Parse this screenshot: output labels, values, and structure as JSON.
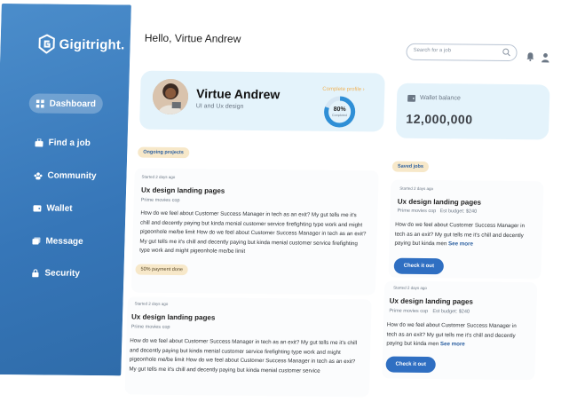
{
  "brand": {
    "name": "Gigitright."
  },
  "sidebar": {
    "items": [
      {
        "label": "Dashboard",
        "icon": "dashboard-icon",
        "active": true
      },
      {
        "label": "Find a job",
        "icon": "briefcase-icon"
      },
      {
        "label": "Community",
        "icon": "community-icon"
      },
      {
        "label": "Wallet",
        "icon": "wallet-icon"
      },
      {
        "label": "Message",
        "icon": "message-icon"
      },
      {
        "label": "Security",
        "icon": "lock-icon"
      }
    ]
  },
  "header": {
    "greeting": "Hello, Virtue Andrew",
    "search_placeholder": "Search for a job"
  },
  "profile": {
    "name": "Virtue Andrew",
    "role": "UI and Ux design",
    "complete_label": "Complete profile",
    "progress_percent": 80,
    "progress_label": "80%",
    "progress_sub": "Completed"
  },
  "wallet": {
    "label": "Wallet balance",
    "value": "12,000,000"
  },
  "ongoing": {
    "tag": "Ongoing projects",
    "projects": [
      {
        "started": "Started 2 days ago",
        "title": "Ux design landing pages",
        "company": "Prime movies cop",
        "desc": "How do we feel about Customer Success Manager in tech as an exit? My gut tells me it's chill and decently paying but kinda menial customer service firefighting type work and might pigeonhole me/be limit How do we feel about Customer Success Manager in tech as an exit? My gut tells me it's chill and decently paying but kinda menial customer service firefighting type work and might pigeonhole me/be limit",
        "badge": "50% payment done"
      },
      {
        "started": "Started 2 days ago",
        "title": "Ux design landing pages",
        "company": "Prime movies cop",
        "desc": "How do we feel about Customer Success Manager in tech as an exit? My gut tells me it's chill and decently paying but kinda menial customer service firefighting type work and might pigeonhole me/be limit How do we feel about Customer Success Manager in tech as an exit? My gut tells me it's chill and decently paying but kinda menial customer service"
      }
    ]
  },
  "saved": {
    "tag": "Saved jobs",
    "jobs": [
      {
        "started": "Started 2 days ago",
        "title": "Ux design landing pages",
        "company": "Prime movies cop",
        "budget": "Est budget: $240",
        "desc": "How do we feel about Customer Success Manager in tech as an exit? My gut tells me it's chill and decently paying but kinda men",
        "see_more": "See more",
        "button": "Check it out"
      },
      {
        "started": "Started 2 days ago",
        "title": "Ux design landing pages",
        "company": "Prime movies cop",
        "budget": "Est budget: $240",
        "desc": "How do we feel about Customer Success Manager in tech as an exit? My gut tells me it's chill and decently paying but kinda men",
        "see_more": "See more",
        "button": "Check it out"
      }
    ]
  },
  "colors": {
    "sidebar": "#3a7dbe",
    "accent": "#2f6fc2",
    "card": "#e4f3fb",
    "badge": "#f7e8c9",
    "progress": "#2f8fd6"
  }
}
